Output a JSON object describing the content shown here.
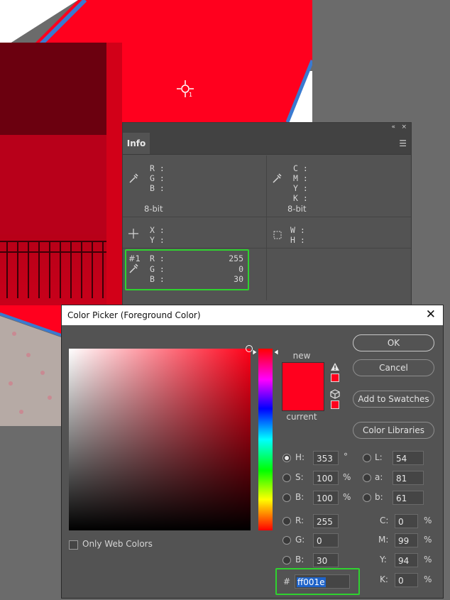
{
  "info_panel": {
    "collapse_icon": "«",
    "close_icon": "×",
    "tab_label": "Info",
    "rgb_labels": [
      "R :",
      "G :",
      "B :"
    ],
    "rgb_bitdepth": "8-bit",
    "cmyk_labels": [
      "C :",
      "M :",
      "Y :",
      "K :"
    ],
    "cmyk_bitdepth": "8-bit",
    "xy_labels": [
      "X :",
      "Y :"
    ],
    "wh_labels": [
      "W :",
      "H :"
    ],
    "sampler": {
      "id": "#1",
      "labels": [
        "R :",
        "G :",
        "B :"
      ],
      "values": [
        "255",
        "0",
        "30"
      ]
    }
  },
  "color_picker": {
    "title": "Color Picker (Foreground Color)",
    "new_label": "new",
    "current_label": "current",
    "new_color": "#ff001e",
    "current_color": "#ff001e",
    "buttons": {
      "ok": "OK",
      "cancel": "Cancel",
      "add_swatches": "Add to Swatches",
      "color_libraries": "Color Libraries"
    },
    "hsb": [
      {
        "label": "H:",
        "value": "353",
        "unit": "°",
        "selected": true
      },
      {
        "label": "S:",
        "value": "100",
        "unit": "%",
        "selected": false
      },
      {
        "label": "B:",
        "value": "100",
        "unit": "%",
        "selected": false
      }
    ],
    "lab": [
      {
        "label": "L:",
        "value": "54"
      },
      {
        "label": "a:",
        "value": "81"
      },
      {
        "label": "b:",
        "value": "61"
      }
    ],
    "rgb": [
      {
        "label": "R:",
        "value": "255"
      },
      {
        "label": "G:",
        "value": "0"
      },
      {
        "label": "B:",
        "value": "30"
      }
    ],
    "cmyk": [
      {
        "label": "C:",
        "value": "0",
        "unit": "%"
      },
      {
        "label": "M:",
        "value": "99",
        "unit": "%"
      },
      {
        "label": "Y:",
        "value": "94",
        "unit": "%"
      },
      {
        "label": "K:",
        "value": "0",
        "unit": "%"
      }
    ],
    "hex_label": "#",
    "hex_value": "ff001e",
    "only_web_colors": "Only Web Colors",
    "only_web_colors_checked": false,
    "hue_field_color": "#ff0018"
  },
  "colors": {
    "highlight": "#2fd22f",
    "canvas_red": "#ff001e",
    "panel_bg": "#535353"
  }
}
